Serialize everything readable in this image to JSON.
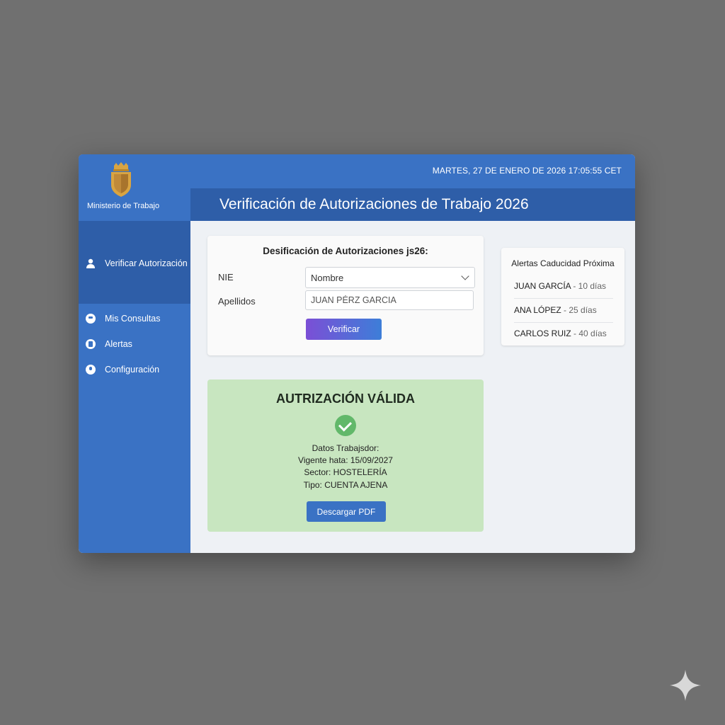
{
  "topbar": {
    "datetime": "MARTES, 27 DE ENERO DE 2026 17:05:55 CET"
  },
  "sidebar": {
    "ministry_name": "Ministerio de Trabajo",
    "items": [
      {
        "label": "Verificar Autorización",
        "icon": "user-icon",
        "active": true
      },
      {
        "label": "Mis Consultas",
        "icon": "consultas-icon"
      },
      {
        "label": "Alertas",
        "icon": "alerts-icon"
      },
      {
        "label": "Configuración",
        "icon": "settings-icon"
      }
    ]
  },
  "header": {
    "title": "Verificación de Autorizaciones de Trabajo 2026"
  },
  "form": {
    "title": "Desificación de Autorizaciones js26:",
    "nie_label": "NIE",
    "nie_select_value": "Nombre",
    "apellidos_label": "Apellidos",
    "apellidos_value": "JUAN PÉRZ GARCIA",
    "verify_label": "Verificar"
  },
  "alerts": {
    "title": "Alertas Caducidad Próxima",
    "items": [
      {
        "name": "JUAN GARCÍA",
        "days": " - 10 días"
      },
      {
        "name": "ANA LÓPEZ",
        "days": " - 25 días"
      },
      {
        "name": "CARLOS RUIZ",
        "days": " - 40 días"
      }
    ]
  },
  "result": {
    "title": "AUTRIZACIÓN VÁLIDA",
    "lines": [
      "Datos Trabajsdor:",
      "Vigente hata: 15/09/2027",
      "Sector: HOSTELERÍA",
      "Tipo: CUENTA AJENA"
    ],
    "download_label": "Descargar PDF"
  },
  "colors": {
    "primary": "#3a72c4",
    "primary_dark": "#2e5ea8",
    "success_bg": "#c8e6c0",
    "success_icon": "#62b86a"
  }
}
